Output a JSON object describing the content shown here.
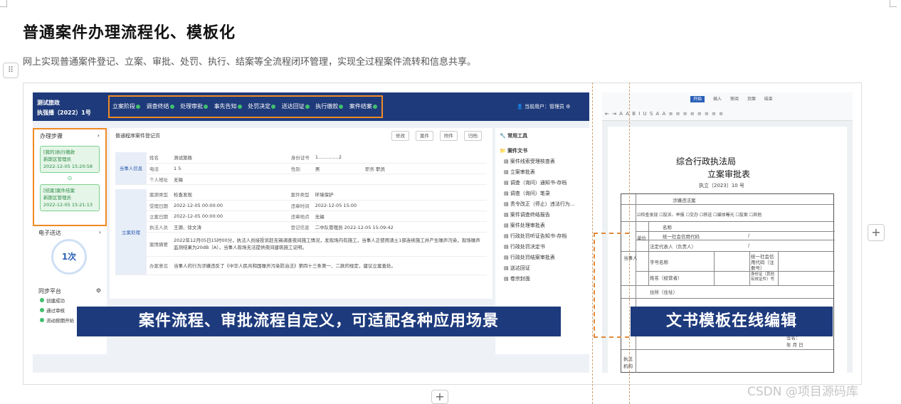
{
  "page": {
    "title": "普通案件办理流程化、模板化",
    "subtitle": "网上实现普通案件登记、立案、审批、处罚、执行、结案等全流程闭环管理，实现全过程案件流转和信息共享。",
    "handle_glyph": "⠿",
    "add_glyph": "+",
    "watermark": "CSDN @项目源码库"
  },
  "left_screen": {
    "org_line1": "测试旅政",
    "org_line2": "执强播（2022）1号",
    "steps": [
      "立案阶段",
      "调查终结",
      "处理审批",
      "事先告知",
      "处罚决定",
      "送达回证",
      "执行缴款",
      "案件结案"
    ],
    "user": "当前用户：管理员",
    "process_section": "办理步骤",
    "cards": [
      {
        "line1": "[我的]执行缴款",
        "line2": "新斯区管理员",
        "line3": "2022-12-05 15:20:58"
      },
      {
        "line1": "[结案]案件结案",
        "line2": "新斯区管理员",
        "line3": "2022-12-05 15:21:13"
      }
    ],
    "delivery_section": "电子送达",
    "delivery_count": "1次",
    "sync_section": "同步平台",
    "sync_items": [
      "创建成功",
      "通过审核",
      "流动按期开始"
    ],
    "form_title": "普通程序案件登记页",
    "form_buttons": [
      "修改",
      "案件",
      "附件",
      "归档"
    ],
    "party_group": "当事人信息",
    "party_rows": [
      [
        "姓名",
        "测试旅政",
        "身份证号",
        "1..............2"
      ],
      [
        "电话",
        "1        5",
        "性别",
        "男",
        "职务",
        "职员"
      ],
      [
        "个人地址",
        "无锡"
      ]
    ],
    "case_group": "立案处理",
    "case_rows": [
      [
        "案源类型",
        "检查发现",
        "案件类型",
        "环境保护"
      ],
      [
        "受理日期",
        "2022-12-05 00:00:00",
        "违章时间",
        "2022-12-05 15:00"
      ],
      [
        "立案日期",
        "2022-12-05 00:00:00",
        "违章地点",
        "无锡"
      ],
      [
        "执法人员",
        "王源、徐文涛",
        "登记信息",
        "二中队管理员 2022-12-05 15:09:42"
      ]
    ],
    "case_summary_label": "案情摘要",
    "case_summary": "2022年12月05日15时00分，执法人员接投诉赶无锡调查夜间施工情况，发现场内有施工，当事人正使用渣土1部连续施工并产生噪声污染，现场噪声监测结果为20dB（A），当事人现场无法提供夜间建筑施工证明。",
    "opinion_label": "办案意见",
    "opinion": "当事人的行为涉嫌违反了《中华人民共和国噪声污染防治法》第四十三条第一、二款的规定，建议立案查处。",
    "tools_section": "常用工具",
    "docs_section": "案件文书",
    "docs": [
      "案件线索受理核查表",
      "立案审批表",
      "调查（询问）通知书-存档",
      "调查（询问）笔录",
      "责令改正（停止）违法行为...",
      "案件调查终结报告",
      "案件处理审批表",
      "行政处罚听证告知书-存档",
      "行政处罚决定书",
      "行政处罚结案审批表",
      "送达回证",
      "卷宗封面"
    ]
  },
  "right_screen": {
    "tabs": [
      "开始",
      "插入",
      "审阅",
      "页面",
      "结束"
    ],
    "toolbar_glyphs": "⇤ ⇥ A A B I U S A A ≡ ≡ ≡ ≡ ≡ ≡ ≡ ≡",
    "doc_org": "综合行政执法局",
    "doc_title": "立案审批表",
    "doc_no": "执立〔2023〕10 号",
    "doc_cells": {
      "case_name": "涉嫌违法案",
      "source": "☑检查发现 ☐投诉、举报 ☐交办 ☐移送 ☐媒体曝光 ☐投案 ☐其他",
      "name": "名称",
      "credit": "统一社会信用代码",
      "legal": "法定代表人（负责人）",
      "person": "个体工商户或个人",
      "trade": "字号名称",
      "credit2": "统一社会信用代码（注册号）",
      "owner": "姓名（经营者）",
      "idno": "身份证（其他有效证件）号",
      "addr": "住所（住址）",
      "sign": "签名：",
      "date": "年   月   日",
      "party": "当事人",
      "unit": "单位",
      "org": "执法机构",
      "slash": "/"
    }
  },
  "banners": {
    "left": "案件流程、审批流程自定义，可适配各种应用场景",
    "right": "文书模板在线编辑"
  },
  "colors": {
    "banner": "#1d3a7c",
    "highlight": "#f08a24",
    "success": "#3fbf6e"
  }
}
